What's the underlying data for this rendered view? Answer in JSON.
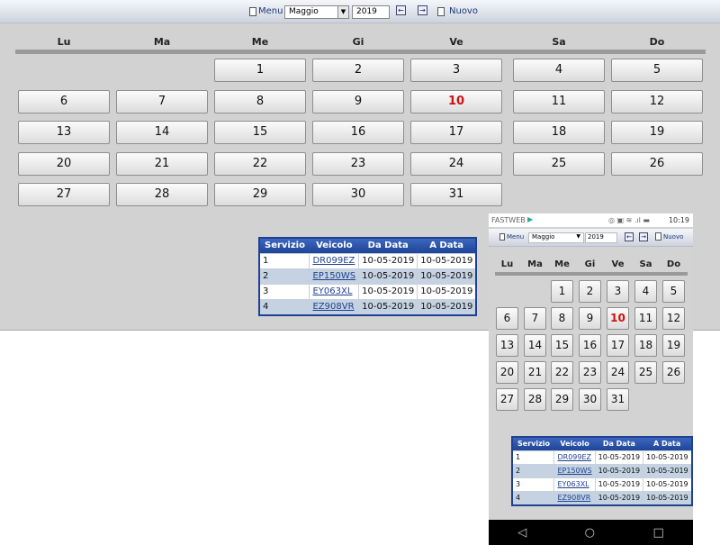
{
  "toolbar": {
    "menu": "Menu",
    "month": "Maggio",
    "year": "2019",
    "prev": "←",
    "next": "→",
    "new": "Nuovo"
  },
  "weekdays": [
    "Lu",
    "Ma",
    "Me",
    "Gi",
    "Ve",
    "Sa",
    "Do"
  ],
  "calendar": {
    "first_weekday_index": 2,
    "days": 31,
    "today": 10
  },
  "table": {
    "headers": [
      "Servizio",
      "Veicolo",
      "Da Data",
      "A Data"
    ],
    "rows": [
      [
        "1",
        "DR099EZ",
        "10-05-2019",
        "10-05-2019"
      ],
      [
        "2",
        "EP150WS",
        "10-05-2019",
        "10-05-2019"
      ],
      [
        "3",
        "EY063XL",
        "10-05-2019",
        "10-05-2019"
      ],
      [
        "4",
        "EZ908VR",
        "10-05-2019",
        "10-05-2019"
      ]
    ]
  },
  "phone": {
    "carrier": "FASTWEB",
    "time": "10:19",
    "status_icons": "◎ ▣ ≋ .ıl ▬",
    "nav": [
      "◁",
      "○",
      "□"
    ]
  }
}
